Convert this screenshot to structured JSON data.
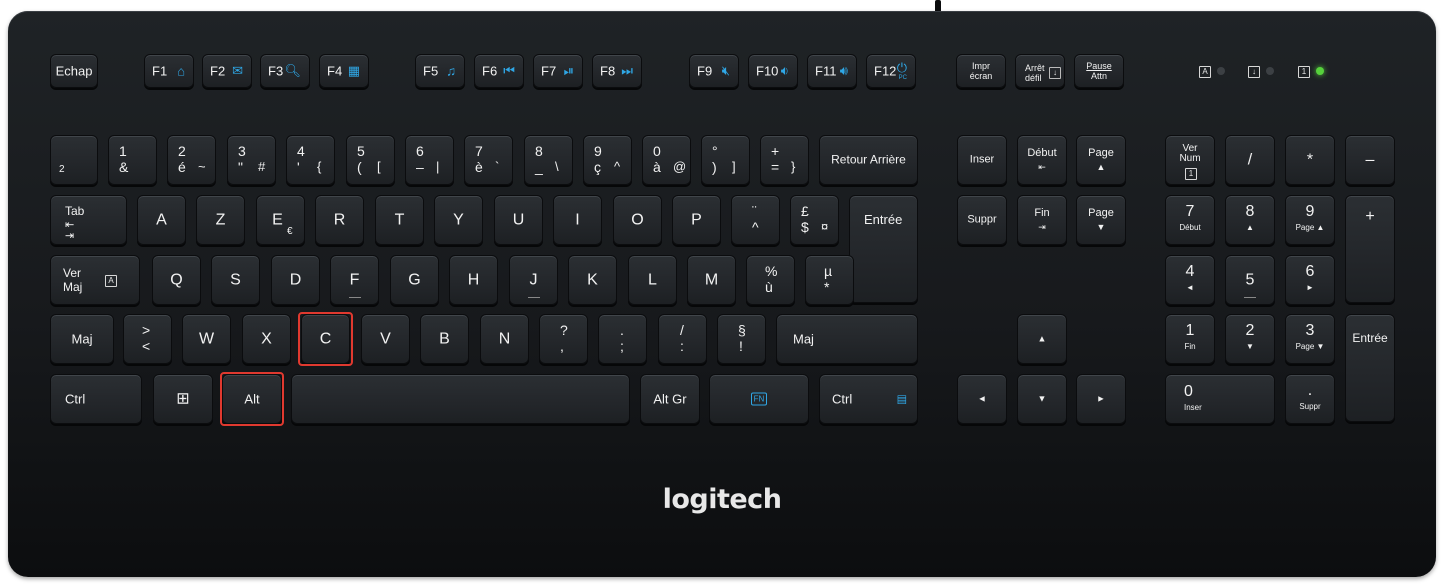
{
  "brand": "logitech",
  "colors": {
    "body": "#1a1d20",
    "key": "#25282c",
    "legend": "#f2f2f2",
    "accent_blue": "#2fa7e6",
    "highlight": "#e0392f",
    "led_on": "#56d23c"
  },
  "highlighted_keys": [
    "C",
    "Alt"
  ],
  "keys": {
    "echap": "Echap",
    "f1": "F1",
    "f1_icon": "⌂",
    "f2": "F2",
    "f2_icon": "✉",
    "f3": "F3",
    "f3_icon": "🔍︎",
    "f4": "F4",
    "f4_icon": "▦",
    "f5": "F5",
    "f5_icon": "♫",
    "f6": "F6",
    "f6_icon": "⏮︎",
    "f7": "F7",
    "f7_icon": "⏯︎",
    "f8": "F8",
    "f8_icon": "⏭︎",
    "f9": "F9",
    "f9_icon": "🔇︎",
    "f10": "F10",
    "f10_icon": "🔉︎",
    "f11": "F11",
    "f11_icon": "🔊︎",
    "f12": "F12",
    "f12_icon": "⏻",
    "f12_sub": "PC",
    "impr_1": "Impr",
    "impr_2": "écran",
    "arret_1": "Arrêt",
    "arret_2": "défil",
    "pause_1": "Pause",
    "pause_2": "Attn",
    "n2": "2",
    "n1_t": "1",
    "n1_b": "&",
    "n2_t": "2",
    "n2_b": "é",
    "n2_br": "~",
    "n3_t": "3",
    "n3_b": "\"",
    "n3_br": "#",
    "n4_t": "4",
    "n4_b": "'",
    "n4_br": "{",
    "n5_t": "5",
    "n5_b": "(",
    "n5_br": "[",
    "n6_t": "6",
    "n6_b": "–",
    "n6_br": "|",
    "n7_t": "7",
    "n7_b": "è",
    "n7_br": "`",
    "n8_t": "8",
    "n8_b": "_",
    "n8_br": "\\",
    "n9_t": "9",
    "n9_b": "ç",
    "n9_br": "^",
    "n0_t": "0",
    "n0_b": "à",
    "n0_br": "@",
    "deg_t": "°",
    "deg_b": ")",
    "deg_br": "]",
    "plus_t": "+",
    "plus_b": "=",
    "plus_br": "}",
    "backspace": "Retour Arrière",
    "tab": "Tab",
    "a": "A",
    "z": "Z",
    "e": "E",
    "e_alt": "€",
    "r": "R",
    "t": "T",
    "y": "Y",
    "u": "U",
    "i": "I",
    "o": "O",
    "p": "P",
    "trema_t": "¨",
    "trema_b": "^",
    "pound_t": "£",
    "pound_b": "$",
    "pound_br": "¤",
    "enter": "Entrée",
    "caps_1": "Ver",
    "caps_2": "Maj",
    "q": "Q",
    "s": "S",
    "d": "D",
    "f": "F",
    "g": "G",
    "h": "H",
    "j": "J",
    "k": "K",
    "l": "L",
    "m": "M",
    "pct_t": "%",
    "pct_b": "ù",
    "mu_t": "µ",
    "mu_b": "*",
    "lshift": "Maj",
    "lt_t": ">",
    "lt_b": "<",
    "w": "W",
    "x": "X",
    "c": "C",
    "v": "V",
    "b": "B",
    "n": "N",
    "q_t": "?",
    "q_b": ",",
    "dot_t": ".",
    "dot_b": ";",
    "slash_t": "/",
    "slash_b": ":",
    "sect_t": "§",
    "sect_b": "!",
    "rshift": "Maj",
    "lctrl": "Ctrl",
    "win": "⊞",
    "alt": "Alt",
    "altgr": "Alt Gr",
    "fn": "FN",
    "rctrl": "Ctrl",
    "rctrl_icon": "▤",
    "inser": "Inser",
    "debut": "Début",
    "debut_icon": "⇤",
    "page": "Page",
    "page_up": "▲",
    "page_down": "▼",
    "suppr": "Suppr",
    "fin": "Fin",
    "fin_icon": "⇥",
    "arrow_up": "▲",
    "arrow_left": "◄",
    "arrow_down": "▼",
    "arrow_right": "►",
    "num_1": "Ver",
    "num_2": "Num",
    "kp_div": "/",
    "kp_mul": "*",
    "kp_minus": "–",
    "kp_plus": "+",
    "kp7": "7",
    "kp7_sub": "Début",
    "kp8": "8",
    "kp8_sub": "▲",
    "kp9": "9",
    "kp9_sub": "Page ▲",
    "kp4": "4",
    "kp4_sub": "◄",
    "kp5": "5",
    "kp6": "6",
    "kp6_sub": "►",
    "kp1": "1",
    "kp1_sub": "Fin",
    "kp2": "2",
    "kp2_sub": "▼",
    "kp3": "3",
    "kp3_sub": "Page ▼",
    "kp0": "0",
    "kp0_sub": "Inser",
    "kpdot": ".",
    "kpdot_sub": "Suppr",
    "kp_enter": "Entrée"
  },
  "leds": [
    {
      "icon": "A",
      "on": false
    },
    {
      "icon": "↓",
      "on": false
    },
    {
      "icon": "1",
      "on": true
    }
  ]
}
